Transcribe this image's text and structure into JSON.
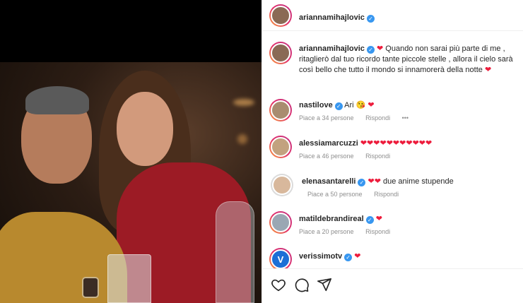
{
  "post": {
    "author": "ariannamihajlovic",
    "caption_user": "ariannamihajlovic",
    "caption_text": "Quando non sarai più parte di me , ritaglierò dal tuo ricordo tante piccole stelle , allora il cielo sarà così bello che tutto il mondo si innamorerà della notte"
  },
  "comments": [
    {
      "user": "nastilove",
      "text": "Ari",
      "emojis": "😘 ❤",
      "likes": "Piace a 34 persone",
      "reply": "Rispondi",
      "more": "•••"
    },
    {
      "user": "alessiamarcuzzi",
      "text": "",
      "emojis": "❤❤❤❤❤❤❤❤❤❤❤",
      "likes": "Piace a 46 persone",
      "reply": "Rispondi"
    },
    {
      "user": "elenasantarelli",
      "text": "due anime stupende",
      "emojis": "❤❤",
      "likes": "Piace a 50 persone",
      "reply": "Rispondi"
    },
    {
      "user": "matildebrandireal",
      "text": "",
      "emojis": "❤",
      "likes": "Piace a 20 persone",
      "reply": "Rispondi"
    },
    {
      "user": "verissimotv",
      "text": "",
      "emojis": "❤",
      "avatar_letter": "V"
    }
  ],
  "colors": {
    "verified": "#3897f0",
    "heart": "#ed1c3c",
    "muted": "#8e8e8e"
  },
  "icons": [
    "heart-outline-icon",
    "comment-icon",
    "share-icon",
    "verified-badge-icon"
  ]
}
